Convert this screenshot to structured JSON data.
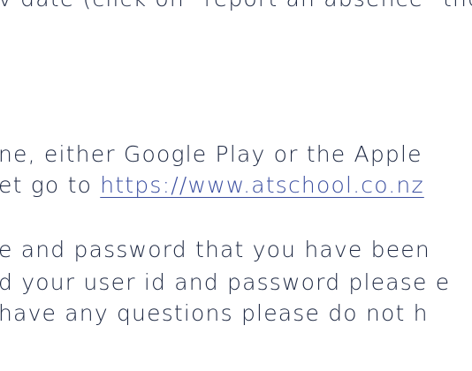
{
  "content": {
    "line1": "v date (click on \"report an absence\" then",
    "line2": "ne, either Google Play or the Apple",
    "line3_prefix": "et go to ",
    "line3_link": "https://www.atschool.co.nz",
    "line4": "e and password that you have been",
    "line5": "d your user id and password please e",
    "line6": "have any questions please do not h"
  }
}
